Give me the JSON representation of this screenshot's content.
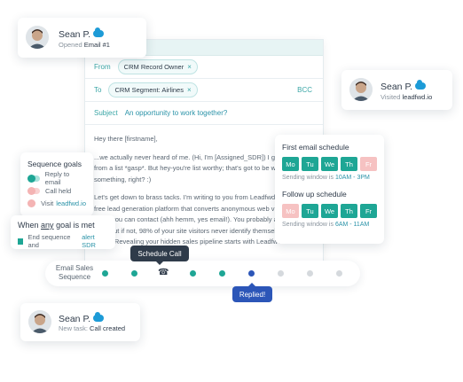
{
  "composer": {
    "from_label": "From",
    "from_chip": "CRM Record Owner",
    "to_label": "To",
    "to_chip": "CRM Segment: Airlines",
    "bcc_label": "BCC",
    "subject_label": "Subject",
    "subject_value": "An opportunity to work together?",
    "body": [
      "Hey there [firstname],",
      "...we actually never heard of me. (Hi, I'm [Assigned_SDR]) I get emails from a list *gasp*. But hey-you're list worthy; that's got to be worth something, right? :)",
      "Let's get down to brass tacks. I'm writing to you from Leadfwd - a friction-free lead generation platform that converts anonymous web visitors into leads you can contact (ahh hemm, yes email!). You probably already know this.. but if not, 98% of your site visitors never identify themselves by filling forms. Revealing your hidden sales pipeline starts with Leadfwd."
    ]
  },
  "contact": {
    "name": "Sean P.",
    "activities": [
      {
        "prefix": "Opened",
        "value": "Email #1"
      },
      {
        "prefix": "Visited",
        "value": "leadfwd.io"
      },
      {
        "prefix": "New task:",
        "value": "Call created"
      }
    ]
  },
  "schedule": {
    "first_title": "First email schedule",
    "first_days": [
      {
        "label": "Mo",
        "active": true
      },
      {
        "label": "Tu",
        "active": true
      },
      {
        "label": "We",
        "active": true
      },
      {
        "label": "Th",
        "active": true
      },
      {
        "label": "Fr",
        "active": false
      }
    ],
    "first_window_label": "Sending window is",
    "first_window_value": "10AM - 3PM",
    "follow_title": "Follow up schedule",
    "follow_days": [
      {
        "label": "Mo",
        "active": false
      },
      {
        "label": "Tu",
        "active": true
      },
      {
        "label": "We",
        "active": true
      },
      {
        "label": "Th",
        "active": true
      },
      {
        "label": "Fr",
        "active": true
      }
    ],
    "follow_window_label": "Sending window is",
    "follow_window_value": "6AM - 11AM"
  },
  "goals": {
    "title": "Sequence goals",
    "items": [
      {
        "label": "Reply to email",
        "on": true,
        "link": ""
      },
      {
        "label": "Call held",
        "on": false,
        "link": ""
      },
      {
        "label": "Visit",
        "on": false,
        "link": "leadfwd.io"
      }
    ]
  },
  "when": {
    "prefix": "When",
    "emph": "any",
    "suffix": "goal is met",
    "action": "End sequence and",
    "action_link": "alert SDR"
  },
  "sequence": {
    "label": "Email Sales Sequence",
    "tooltip": "Schedule Call",
    "replied": "Replied!",
    "steps": [
      "done",
      "done",
      "phone",
      "done",
      "done",
      "current",
      "todo",
      "todo",
      "todo"
    ]
  },
  "colors": {
    "accent": "#1ea695",
    "link": "#2b93a8",
    "replied": "#2c56b8",
    "inactive_day": "#f6c2c2",
    "salesforce": "#1d9bd7"
  },
  "icons": [
    "salesforce-cloud-icon",
    "phone-icon",
    "close-icon",
    "avatar"
  ]
}
